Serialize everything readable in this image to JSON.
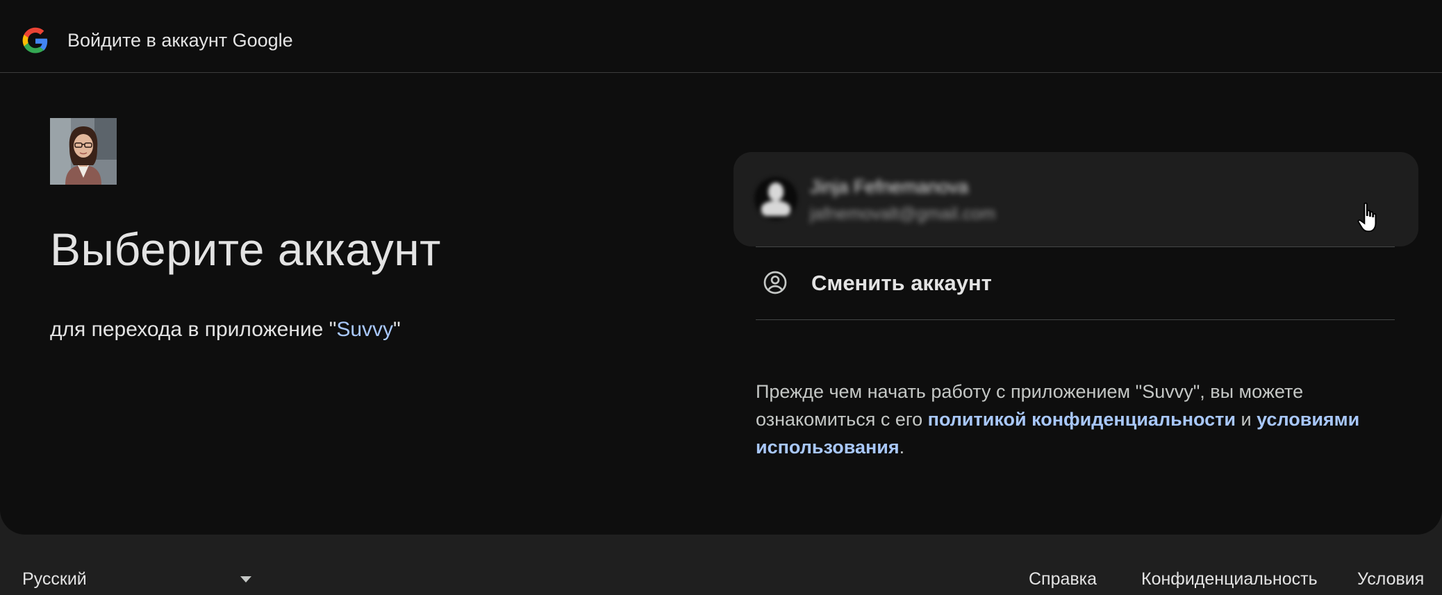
{
  "header": {
    "title": "Войдите в аккаунт Google",
    "logo_icon": "google-g-logo"
  },
  "main": {
    "app_icon": "app-avatar-woman-with-glasses",
    "title": "Выберите аккаунт",
    "subtitle_prefix": "для перехода в приложение \"",
    "app_name": "Suvvy",
    "subtitle_suffix": "\""
  },
  "account": {
    "name": "Jinja Fefnemanova",
    "email": "jafnemovalt@gmail.com",
    "avatar_icon": "person-silhouette-icon"
  },
  "switch_account": {
    "label": "Сменить аккаунт",
    "icon": "account-circle-icon"
  },
  "disclaimer": {
    "text_1": "Прежде чем начать работу с приложением \"Suvvy\", вы можете ознакомиться с его ",
    "privacy_link": "политикой конфиденциальности",
    "text_2": " и ",
    "terms_link": "условиями использования",
    "text_3": "."
  },
  "footer": {
    "language": "Русский",
    "help": "Справка",
    "privacy": "Конфиденциальность",
    "terms": "Условия"
  },
  "colors": {
    "card_bg": "#0e0e0e",
    "page_bg": "#1f1f1f",
    "link": "#a8c7fa",
    "text": "#e3e3e3"
  }
}
